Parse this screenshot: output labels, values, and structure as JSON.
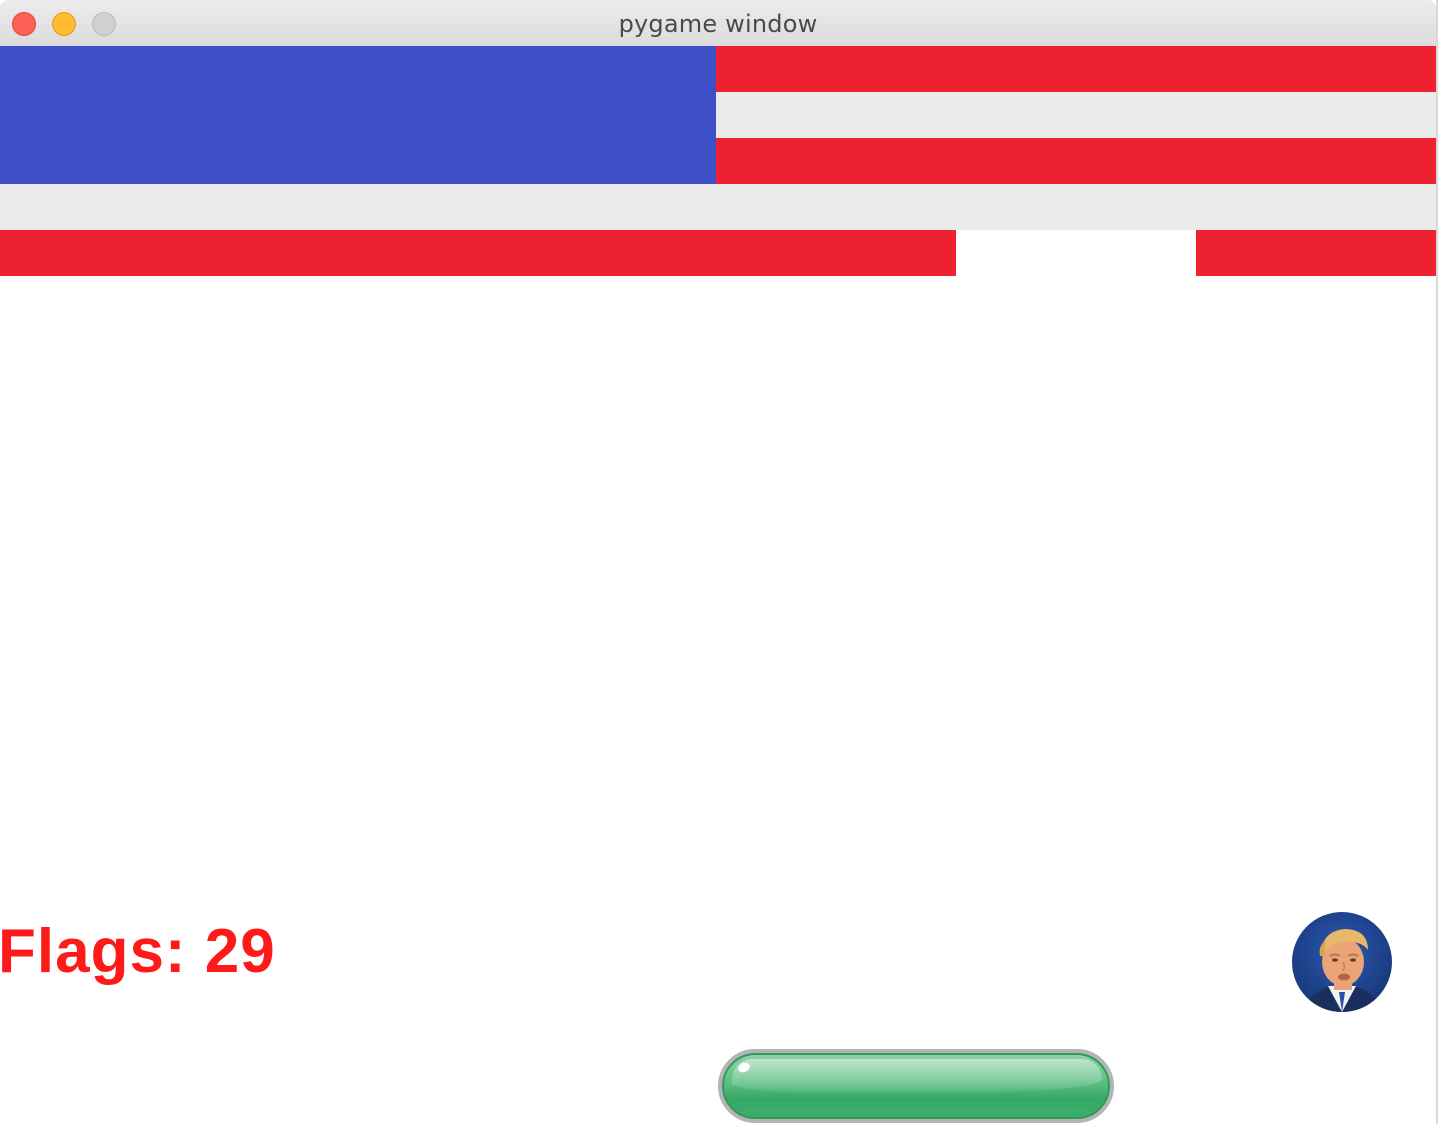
{
  "window": {
    "title": "pygame window"
  },
  "hud": {
    "flags_text": "Flags: 29",
    "flags_color": "#ff1a1a"
  },
  "colors": {
    "brick_red": "#ed212f",
    "brick_white": "#ebebeb",
    "brick_blue": "#3f4fc8",
    "paddle_green": "#3fae6d"
  },
  "bricks": {
    "rows": [
      {
        "row": 1,
        "cells": [
          "blue",
          "red"
        ]
      },
      {
        "row": 2,
        "cells": [
          "blue",
          "white"
        ]
      },
      {
        "row": 3,
        "cells": [
          "blue",
          "red"
        ]
      },
      {
        "row": 4,
        "cells": [
          "white"
        ]
      },
      {
        "row": 5,
        "cells": [
          "red",
          "empty",
          "red"
        ]
      }
    ]
  },
  "icons": {
    "ball": "face-ball-icon",
    "paddle": "paddle"
  }
}
